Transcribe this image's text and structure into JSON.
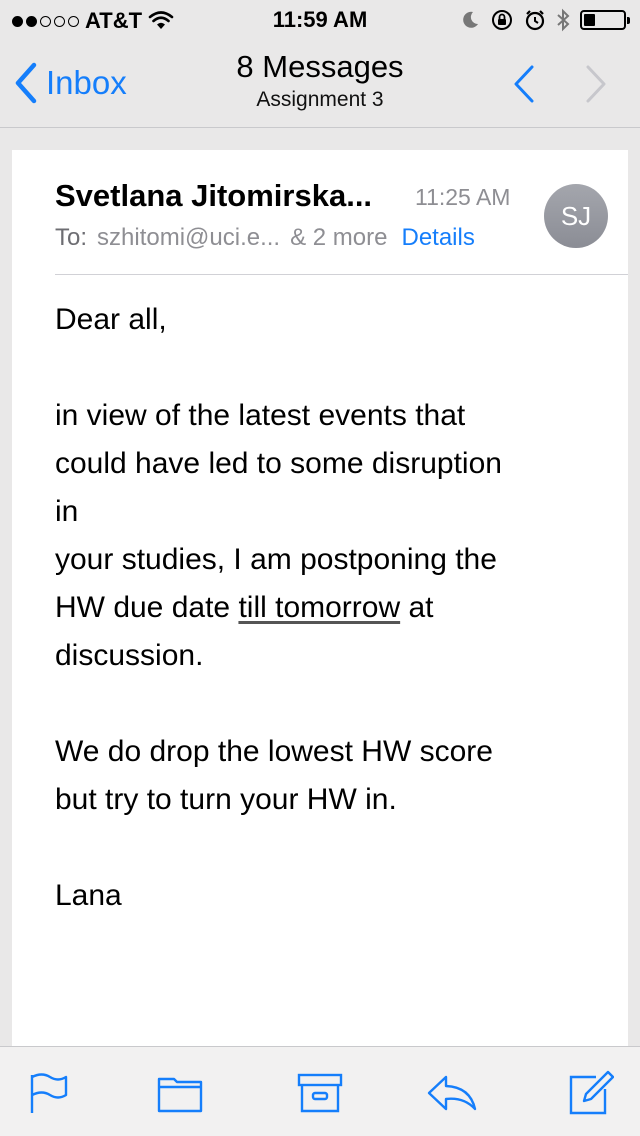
{
  "status_bar": {
    "carrier": "AT&T",
    "time": "11:59 AM",
    "signal_strength": 2,
    "battery_level": 0.3,
    "icons": [
      "wifi-icon",
      "moon-icon",
      "orientation-lock-icon",
      "alarm-icon",
      "bluetooth-icon",
      "battery-icon"
    ]
  },
  "nav": {
    "back_label": "Inbox",
    "title": "8 Messages",
    "subtitle": "Assignment 3"
  },
  "message": {
    "sender": "Svetlana Jitomirska...",
    "time": "11:25 AM",
    "avatar_initials": "SJ",
    "to_label": "To:",
    "to_value": "szhitomi@uci.e...",
    "more": "& 2 more",
    "details": "Details",
    "body": {
      "greeting": "Dear all,",
      "line1": "in view of the latest events that",
      "line2": "could have led to some disruption",
      "line3": "in",
      "line4": "your studies, I am postponing the",
      "line5_pre": "HW due date ",
      "line5_link": "till tomorrow",
      "line5_post": " at",
      "line6": "discussion.",
      "line7": "We do drop the lowest HW score",
      "line8": "but try to turn your HW in.",
      "signature": "Lana"
    }
  },
  "toolbar": {
    "items": [
      "flag-icon",
      "folder-icon",
      "archive-icon",
      "reply-icon",
      "compose-icon"
    ]
  },
  "colors": {
    "accent": "#157efb",
    "secondary_text": "#8e8e93",
    "avatar": "#9a9ca3"
  }
}
